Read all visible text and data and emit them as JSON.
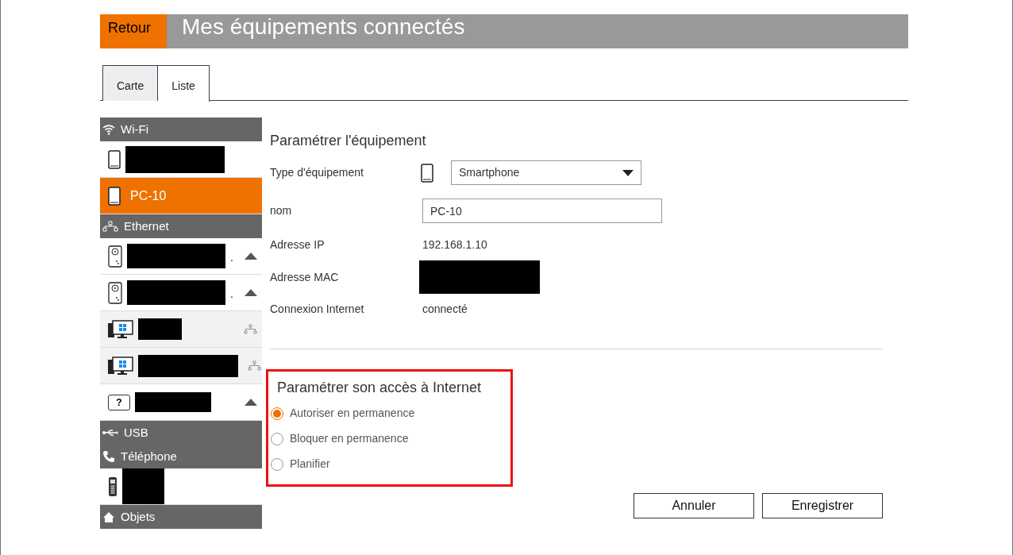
{
  "header": {
    "back_button": "Retour",
    "title": "Mes équipements connectés"
  },
  "tabs": [
    {
      "label": "Carte",
      "selected": false
    },
    {
      "label": "Liste",
      "selected": true
    }
  ],
  "sidebar": [
    {
      "kind": "wifi",
      "label": "Wi-Fi"
    },
    {
      "kind": "smartphone",
      "selected": false
    },
    {
      "kind": "smartphone",
      "selected": true,
      "label": "PC-10"
    },
    {
      "kind": "ethernet",
      "label": "Ethernet"
    },
    {
      "kind": "powerline",
      "selected": false,
      "suffix": "."
    },
    {
      "kind": "powerline",
      "selected": false,
      "suffix": "."
    },
    {
      "kind": "computer",
      "selected": false
    },
    {
      "kind": "computer",
      "selected": false
    },
    {
      "kind": "unknown",
      "selected": false,
      "icon_text": "?"
    },
    {
      "kind": "usb",
      "label": "USB"
    },
    {
      "kind": "telephony",
      "label": "Téléphone"
    },
    {
      "kind": "handset",
      "selected": false
    },
    {
      "kind": "objects",
      "label": "Objets"
    }
  ],
  "device_settings": {
    "title": "Paramétrer l'équipement",
    "fields": [
      {
        "kind": "select",
        "label": "Type d'équipement",
        "value": "Smartphone"
      },
      {
        "kind": "input",
        "label": "nom",
        "value": "PC-10"
      },
      {
        "kind": "text",
        "label": "Adresse IP",
        "value": "192.168.1.10"
      },
      {
        "kind": "redacted",
        "label": "Adresse MAC"
      },
      {
        "kind": "text",
        "label": "Connexion Internet",
        "value": "connecté"
      }
    ]
  },
  "internet_access": {
    "title": "Paramétrer son accès à Internet",
    "options": [
      {
        "label": "Autoriser en permanence",
        "selected": true
      },
      {
        "label": "Bloquer en permanence",
        "selected": false
      },
      {
        "label": "Planifier",
        "selected": false
      }
    ]
  },
  "buttons": [
    "Annuler",
    "Enregistrer"
  ]
}
